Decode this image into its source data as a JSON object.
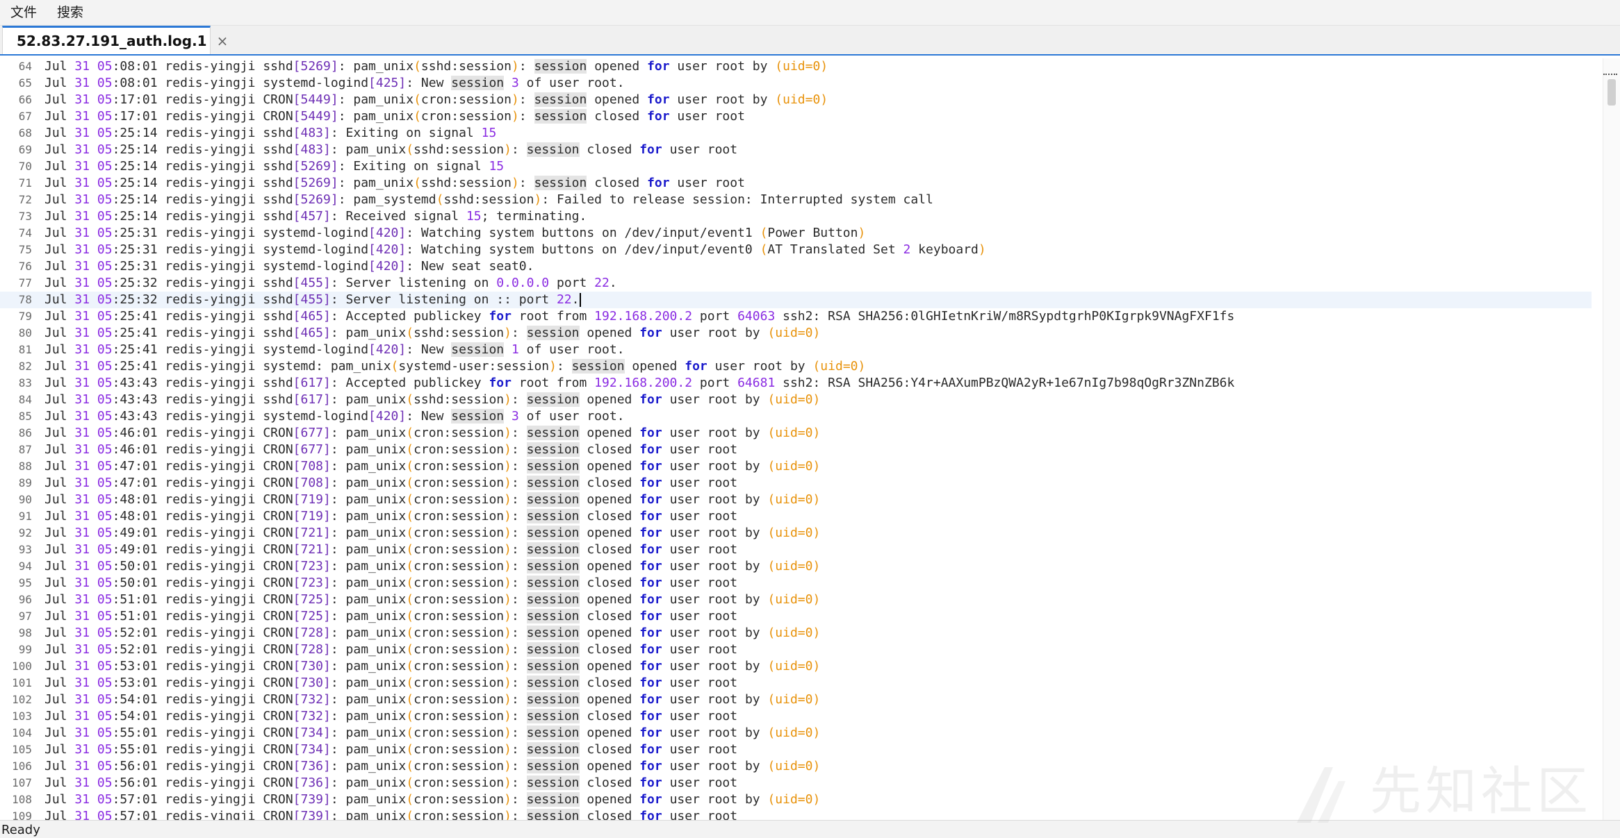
{
  "menu": {
    "file": "文件",
    "search": "搜索"
  },
  "tab": {
    "title": "52.83.27.191_auth.log.1",
    "close": "×"
  },
  "status": {
    "text": "Ready"
  },
  "watermark": "先知社区",
  "current_line": 78,
  "lines": [
    {
      "n": "64",
      "t": "05:08:01",
      "proc": "sshd",
      "pid": "5269",
      "msg": "pam_unix(sshd:session): session opened for user root by (uid=0)"
    },
    {
      "n": "65",
      "t": "05:08:01",
      "proc": "systemd-logind",
      "pid": "425",
      "msg": "New session 3 of user root."
    },
    {
      "n": "66",
      "t": "05:17:01",
      "proc": "CRON",
      "pid": "5449",
      "msg": "pam_unix(cron:session): session opened for user root by (uid=0)"
    },
    {
      "n": "67",
      "t": "05:17:01",
      "proc": "CRON",
      "pid": "5449",
      "msg": "pam_unix(cron:session): session closed for user root"
    },
    {
      "n": "68",
      "t": "05:25:14",
      "proc": "sshd",
      "pid": "483",
      "msg": "Exiting on signal 15"
    },
    {
      "n": "69",
      "t": "05:25:14",
      "proc": "sshd",
      "pid": "483",
      "msg": "pam_unix(sshd:session): session closed for user root"
    },
    {
      "n": "70",
      "t": "05:25:14",
      "proc": "sshd",
      "pid": "5269",
      "msg": "Exiting on signal 15"
    },
    {
      "n": "71",
      "t": "05:25:14",
      "proc": "sshd",
      "pid": "5269",
      "msg": "pam_unix(sshd:session): session closed for user root"
    },
    {
      "n": "72",
      "t": "05:25:14",
      "proc": "sshd",
      "pid": "5269",
      "msg": "pam_systemd(sshd:session): Failed to release session: Interrupted system call"
    },
    {
      "n": "73",
      "t": "05:25:14",
      "proc": "sshd",
      "pid": "457",
      "msg": "Received signal 15; terminating."
    },
    {
      "n": "74",
      "t": "05:25:31",
      "proc": "systemd-logind",
      "pid": "420",
      "msg": "Watching system buttons on /dev/input/event1 (Power Button)"
    },
    {
      "n": "75",
      "t": "05:25:31",
      "proc": "systemd-logind",
      "pid": "420",
      "msg": "Watching system buttons on /dev/input/event0 (AT Translated Set 2 keyboard)"
    },
    {
      "n": "76",
      "t": "05:25:31",
      "proc": "systemd-logind",
      "pid": "420",
      "msg": "New seat seat0."
    },
    {
      "n": "77",
      "t": "05:25:32",
      "proc": "sshd",
      "pid": "455",
      "msg": "Server listening on 0.0.0.0 port 22."
    },
    {
      "n": "78",
      "t": "05:25:32",
      "proc": "sshd",
      "pid": "455",
      "msg": "Server listening on :: port 22."
    },
    {
      "n": "79",
      "t": "05:25:41",
      "proc": "sshd",
      "pid": "465",
      "msg": "Accepted publickey for root from 192.168.200.2 port 64063 ssh2: RSA SHA256:0lGHIetnKriW/m8RSypdtgrhP0KIgrpk9VNAgFXF1fs"
    },
    {
      "n": "80",
      "t": "05:25:41",
      "proc": "sshd",
      "pid": "465",
      "msg": "pam_unix(sshd:session): session opened for user root by (uid=0)"
    },
    {
      "n": "81",
      "t": "05:25:41",
      "proc": "systemd-logind",
      "pid": "420",
      "msg": "New session 1 of user root."
    },
    {
      "n": "82",
      "t": "05:25:41",
      "proc": "systemd",
      "pid": "",
      "msg": "pam_unix(systemd-user:session): session opened for user root by (uid=0)"
    },
    {
      "n": "83",
      "t": "05:43:43",
      "proc": "sshd",
      "pid": "617",
      "msg": "Accepted publickey for root from 192.168.200.2 port 64681 ssh2: RSA SHA256:Y4r+AAXumPBzQWA2yR+1e67nIg7b98qOgRr3ZNnZB6k"
    },
    {
      "n": "84",
      "t": "05:43:43",
      "proc": "sshd",
      "pid": "617",
      "msg": "pam_unix(sshd:session): session opened for user root by (uid=0)"
    },
    {
      "n": "85",
      "t": "05:43:43",
      "proc": "systemd-logind",
      "pid": "420",
      "msg": "New session 3 of user root."
    },
    {
      "n": "86",
      "t": "05:46:01",
      "proc": "CRON",
      "pid": "677",
      "msg": "pam_unix(cron:session): session opened for user root by (uid=0)"
    },
    {
      "n": "87",
      "t": "05:46:01",
      "proc": "CRON",
      "pid": "677",
      "msg": "pam_unix(cron:session): session closed for user root"
    },
    {
      "n": "88",
      "t": "05:47:01",
      "proc": "CRON",
      "pid": "708",
      "msg": "pam_unix(cron:session): session opened for user root by (uid=0)"
    },
    {
      "n": "89",
      "t": "05:47:01",
      "proc": "CRON",
      "pid": "708",
      "msg": "pam_unix(cron:session): session closed for user root"
    },
    {
      "n": "90",
      "t": "05:48:01",
      "proc": "CRON",
      "pid": "719",
      "msg": "pam_unix(cron:session): session opened for user root by (uid=0)"
    },
    {
      "n": "91",
      "t": "05:48:01",
      "proc": "CRON",
      "pid": "719",
      "msg": "pam_unix(cron:session): session closed for user root"
    },
    {
      "n": "92",
      "t": "05:49:01",
      "proc": "CRON",
      "pid": "721",
      "msg": "pam_unix(cron:session): session opened for user root by (uid=0)"
    },
    {
      "n": "93",
      "t": "05:49:01",
      "proc": "CRON",
      "pid": "721",
      "msg": "pam_unix(cron:session): session closed for user root"
    },
    {
      "n": "94",
      "t": "05:50:01",
      "proc": "CRON",
      "pid": "723",
      "msg": "pam_unix(cron:session): session opened for user root by (uid=0)"
    },
    {
      "n": "95",
      "t": "05:50:01",
      "proc": "CRON",
      "pid": "723",
      "msg": "pam_unix(cron:session): session closed for user root"
    },
    {
      "n": "96",
      "t": "05:51:01",
      "proc": "CRON",
      "pid": "725",
      "msg": "pam_unix(cron:session): session opened for user root by (uid=0)"
    },
    {
      "n": "97",
      "t": "05:51:01",
      "proc": "CRON",
      "pid": "725",
      "msg": "pam_unix(cron:session): session closed for user root"
    },
    {
      "n": "98",
      "t": "05:52:01",
      "proc": "CRON",
      "pid": "728",
      "msg": "pam_unix(cron:session): session opened for user root by (uid=0)"
    },
    {
      "n": "99",
      "t": "05:52:01",
      "proc": "CRON",
      "pid": "728",
      "msg": "pam_unix(cron:session): session closed for user root"
    },
    {
      "n": "100",
      "t": "05:53:01",
      "proc": "CRON",
      "pid": "730",
      "msg": "pam_unix(cron:session): session opened for user root by (uid=0)"
    },
    {
      "n": "101",
      "t": "05:53:01",
      "proc": "CRON",
      "pid": "730",
      "msg": "pam_unix(cron:session): session closed for user root"
    },
    {
      "n": "102",
      "t": "05:54:01",
      "proc": "CRON",
      "pid": "732",
      "msg": "pam_unix(cron:session): session opened for user root by (uid=0)"
    },
    {
      "n": "103",
      "t": "05:54:01",
      "proc": "CRON",
      "pid": "732",
      "msg": "pam_unix(cron:session): session closed for user root"
    },
    {
      "n": "104",
      "t": "05:55:01",
      "proc": "CRON",
      "pid": "734",
      "msg": "pam_unix(cron:session): session opened for user root by (uid=0)"
    },
    {
      "n": "105",
      "t": "05:55:01",
      "proc": "CRON",
      "pid": "734",
      "msg": "pam_unix(cron:session): session closed for user root"
    },
    {
      "n": "106",
      "t": "05:56:01",
      "proc": "CRON",
      "pid": "736",
      "msg": "pam_unix(cron:session): session opened for user root by (uid=0)"
    },
    {
      "n": "107",
      "t": "05:56:01",
      "proc": "CRON",
      "pid": "736",
      "msg": "pam_unix(cron:session): session closed for user root"
    },
    {
      "n": "108",
      "t": "05:57:01",
      "proc": "CRON",
      "pid": "739",
      "msg": "pam_unix(cron:session): session opened for user root by (uid=0)"
    },
    {
      "n": "109",
      "t": "05:57:01",
      "proc": "CRON",
      "pid": "739",
      "msg": "pam_unix(cron:session): session closed for user root"
    }
  ],
  "log_prefix": {
    "month": "Jul",
    "day": "31",
    "host": "redis-yingji"
  }
}
